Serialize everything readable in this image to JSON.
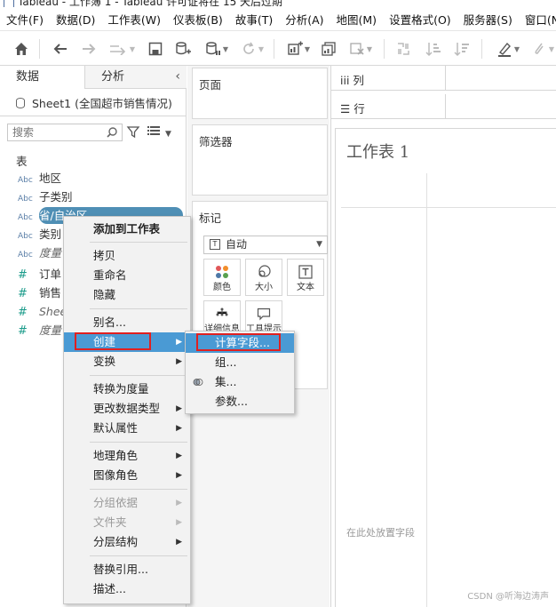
{
  "window": {
    "title": "Tableau - 工作簿 1 - Tableau 许可证将在 15 天后过期"
  },
  "menubar": [
    "文件(F)",
    "数据(D)",
    "工作表(W)",
    "仪表板(B)",
    "故事(T)",
    "分析(A)",
    "地图(M)",
    "设置格式(O)",
    "服务器(S)",
    "窗口(N)"
  ],
  "left": {
    "tabs": {
      "data": "数据",
      "analysis": "分析"
    },
    "datasource": "Sheet1 (全国超市销售情况)",
    "search_placeholder": "搜索",
    "section": "表",
    "fields": [
      {
        "type": "Abc",
        "name": "地区"
      },
      {
        "type": "Abc",
        "name": "子类别"
      },
      {
        "type": "Abc",
        "name": "省/自治区"
      },
      {
        "type": "Abc",
        "name": "类别"
      },
      {
        "type": "Abc",
        "name": "度量"
      },
      {
        "type": "#",
        "name": "订单"
      },
      {
        "type": "#",
        "name": "销售"
      },
      {
        "type": "#",
        "name": "Shee"
      },
      {
        "type": "#",
        "name": "度量"
      }
    ]
  },
  "middle": {
    "pages": "页面",
    "filters": "筛选器",
    "marks": "标记",
    "mark_type": "自动",
    "mark_buttons": {
      "color": "颜色",
      "size": "大小",
      "text": "文本",
      "detail": "详细信息",
      "tooltip": "工具提示"
    }
  },
  "right": {
    "columns": "列",
    "rows": "行",
    "sheet_title": "工作表 1",
    "drop_hint": "在此处放置字段",
    "watermark": "CSDN @听海边涛声"
  },
  "context_menu": {
    "items": [
      "添加到工作表",
      "拷贝",
      "重命名",
      "隐藏",
      "别名...",
      "创建",
      "变换",
      "转换为度量",
      "更改数据类型",
      "默认属性",
      "地理角色",
      "图像角色",
      "分组依据",
      "文件夹",
      "分层结构",
      "替换引用...",
      "描述..."
    ],
    "submenu": [
      "计算字段...",
      "组...",
      "集...",
      "参数..."
    ]
  },
  "colors": {
    "selected_pill": "#4f8fb5",
    "highlight": "#4a9ad4",
    "annotation": "#e02020"
  }
}
